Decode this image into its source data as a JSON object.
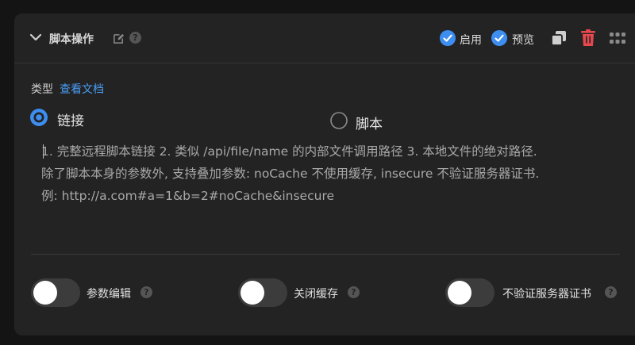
{
  "header": {
    "title": "脚本操作",
    "help": "?",
    "enable_label": "启用",
    "preview_label": "预览"
  },
  "type_row": {
    "label": "类型",
    "doc_link": "查看文档"
  },
  "radios": [
    {
      "label": "链接",
      "selected": true
    },
    {
      "label": "脚本",
      "selected": false
    }
  ],
  "script_input": {
    "text": "1. 完整远程脚本链接 2. 类似 /api/file/name 的内部文件调用路径 3. 本地文件的绝对路径.\n除了脚本本身的参数外, 支持叠加参数: noCache 不使用缓存, insecure 不验证服务器证书.\n例: http://a.com#a=1&b=2#noCache&insecure"
  },
  "toggles": [
    {
      "label": "参数编辑",
      "help": "?",
      "on": false
    },
    {
      "label": "关闭缓存",
      "help": "?",
      "on": false
    },
    {
      "label": "不验证服务器证书",
      "help": "?",
      "on": false
    }
  ],
  "colors": {
    "accent": "#3d8ef0",
    "danger": "#e5484d",
    "link": "#4a9cf5"
  }
}
